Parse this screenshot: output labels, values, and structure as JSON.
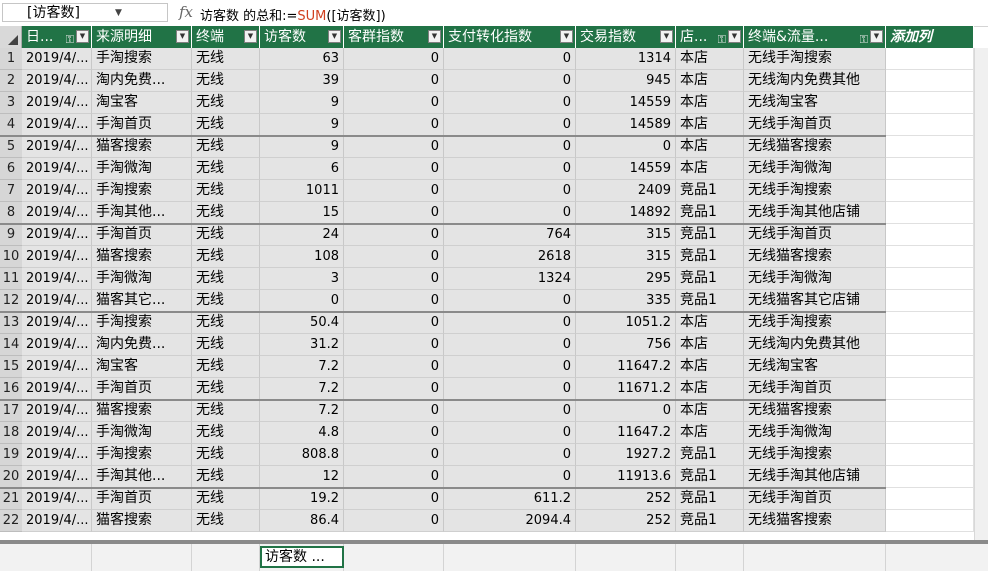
{
  "formula_bar": {
    "name_box": "[访客数]",
    "fx_label": "fx",
    "formula_prefix": "访客数 的总和:=",
    "formula_func": "SUM",
    "formula_arg": "([访客数])"
  },
  "columns": [
    {
      "label": "日..."
    },
    {
      "label": "来源明细"
    },
    {
      "label": "终端"
    },
    {
      "label": "访客数"
    },
    {
      "label": "客群指数"
    },
    {
      "label": "支付转化指数"
    },
    {
      "label": "交易指数"
    },
    {
      "label": "店..."
    },
    {
      "label": "终端&流量..."
    }
  ],
  "add_column_label": "添加列",
  "rows": [
    [
      "1",
      "2019/4/...",
      "手淘搜索",
      "无线",
      "63",
      "0",
      "0",
      "1314",
      "本店",
      "无线手淘搜索"
    ],
    [
      "2",
      "2019/4/...",
      "淘内免费...",
      "无线",
      "39",
      "0",
      "0",
      "945",
      "本店",
      "无线淘内免费其他"
    ],
    [
      "3",
      "2019/4/...",
      "淘宝客",
      "无线",
      "9",
      "0",
      "0",
      "14559",
      "本店",
      "无线淘宝客"
    ],
    [
      "4",
      "2019/4/...",
      "手淘首页",
      "无线",
      "9",
      "0",
      "0",
      "14589",
      "本店",
      "无线手淘首页"
    ],
    [
      "5",
      "2019/4/...",
      "猫客搜索",
      "无线",
      "9",
      "0",
      "0",
      "0",
      "本店",
      "无线猫客搜索"
    ],
    [
      "6",
      "2019/4/...",
      "手淘微淘",
      "无线",
      "6",
      "0",
      "0",
      "14559",
      "本店",
      "无线手淘微淘"
    ],
    [
      "7",
      "2019/4/...",
      "手淘搜索",
      "无线",
      "1011",
      "0",
      "0",
      "2409",
      "竞品1",
      "无线手淘搜索"
    ],
    [
      "8",
      "2019/4/...",
      "手淘其他...",
      "无线",
      "15",
      "0",
      "0",
      "14892",
      "竞品1",
      "无线手淘其他店铺"
    ],
    [
      "9",
      "2019/4/...",
      "手淘首页",
      "无线",
      "24",
      "0",
      "764",
      "315",
      "竞品1",
      "无线手淘首页"
    ],
    [
      "10",
      "2019/4/...",
      "猫客搜索",
      "无线",
      "108",
      "0",
      "2618",
      "315",
      "竞品1",
      "无线猫客搜索"
    ],
    [
      "11",
      "2019/4/...",
      "手淘微淘",
      "无线",
      "3",
      "0",
      "1324",
      "295",
      "竞品1",
      "无线手淘微淘"
    ],
    [
      "12",
      "2019/4/...",
      "猫客其它...",
      "无线",
      "0",
      "0",
      "0",
      "335",
      "竞品1",
      "无线猫客其它店铺"
    ],
    [
      "13",
      "2019/4/...",
      "手淘搜索",
      "无线",
      "50.4",
      "0",
      "0",
      "1051.2",
      "本店",
      "无线手淘搜索"
    ],
    [
      "14",
      "2019/4/...",
      "淘内免费...",
      "无线",
      "31.2",
      "0",
      "0",
      "756",
      "本店",
      "无线淘内免费其他"
    ],
    [
      "15",
      "2019/4/...",
      "淘宝客",
      "无线",
      "7.2",
      "0",
      "0",
      "11647.2",
      "本店",
      "无线淘宝客"
    ],
    [
      "16",
      "2019/4/...",
      "手淘首页",
      "无线",
      "7.2",
      "0",
      "0",
      "11671.2",
      "本店",
      "无线手淘首页"
    ],
    [
      "17",
      "2019/4/...",
      "猫客搜索",
      "无线",
      "7.2",
      "0",
      "0",
      "0",
      "本店",
      "无线猫客搜索"
    ],
    [
      "18",
      "2019/4/...",
      "手淘微淘",
      "无线",
      "4.8",
      "0",
      "0",
      "11647.2",
      "本店",
      "无线手淘微淘"
    ],
    [
      "19",
      "2019/4/...",
      "手淘搜索",
      "无线",
      "808.8",
      "0",
      "0",
      "1927.2",
      "竞品1",
      "无线手淘搜索"
    ],
    [
      "20",
      "2019/4/...",
      "手淘其他...",
      "无线",
      "12",
      "0",
      "0",
      "11913.6",
      "竞品1",
      "无线手淘其他店铺"
    ],
    [
      "21",
      "2019/4/...",
      "手淘首页",
      "无线",
      "19.2",
      "0",
      "611.2",
      "252",
      "竞品1",
      "无线手淘首页"
    ],
    [
      "22",
      "2019/4/...",
      "猫客搜索",
      "无线",
      "86.4",
      "0",
      "2094.4",
      "252",
      "竞品1",
      "无线猫客搜索"
    ]
  ],
  "calc_area": {
    "measure_label": "访客数 ..."
  },
  "colors": {
    "header_bg": "#217346",
    "header_fg": "#ffffff",
    "cell_bg": "#e4e4e4",
    "formula_func": "#d04020"
  }
}
